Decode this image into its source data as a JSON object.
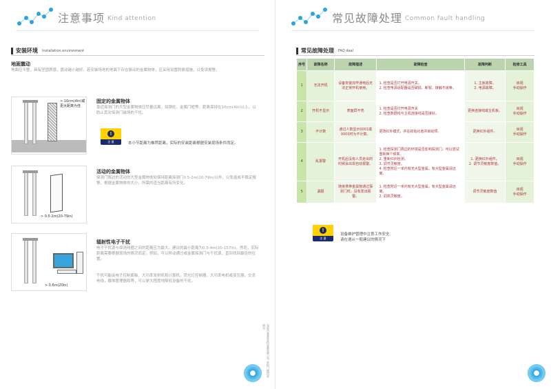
{
  "left": {
    "header": {
      "title": "注意事项",
      "title_en": "Kind attention"
    },
    "section": {
      "title": "安装环境",
      "title_en": "Installation environment"
    },
    "ground": {
      "title": "地面震动",
      "text": "地面应平整，具有坚固质感，震动越小越好。若安装场地的地面下存在振动的金属物体，应采用设置防振措施，以免误报警。"
    },
    "fig1": {
      "label": "> 10cm(4in)或更大距离为佳"
    },
    "fixed_metal": {
      "title": "固定的金属物体",
      "text": "靠近探测门的大型金属物体应尽量远离，如钢柱、金属门框等，距离保持在10cm(4in)以上，以防止其对探测门磁场的干扰。"
    },
    "note1": "本小节距离为推荐距离，实际的安装距离根据安装现场条件而定。",
    "warn_label": "注 意",
    "fig2": {
      "label": "> 0.5-2m(20-79in)"
    },
    "moving_metal": {
      "title": "活动的金属物体",
      "text": "探测门周边的活动的大型金属物体如保持距离探测门0.5-2m(20-79in)以外，以免造成不稳定报警。根据金属物体的大小，所需的适当距离有所变化。"
    },
    "fig3": {
      "label": "> 0.6m(20in)"
    },
    "radiation": {
      "title": "辐射性电子干扰",
      "text1": "电子干扰源与探测线圈之间的距离应为最大。建议的最小距离为0.5-4m(20-157in)。然而，实际距离需要根据现场的情况而定。例如，可以移动通过或金属探测门与干扰源，直到找到最佳的位置。",
      "text2": "干扰可能由电子控制面板、大功率发射机和计算机，荧光灯控制器，大功率电机或变压器，交流电线，载体管理器和等，可以更大程度地降低设备的干扰。"
    },
    "sidebar_text": "深圳市某某安检设备有限公司 安检门使用说明书"
  },
  "right": {
    "header": {
      "title": "常见故障处理",
      "title_en": "Common fault handling"
    },
    "section": {
      "title": "常见故障处理",
      "title_en": "FAQ deal"
    },
    "table": {
      "headers": [
        "序号",
        "故障名称",
        "故障描述",
        "故障检查",
        "故障判断",
        "检修工具"
      ],
      "rows": [
        {
          "num": "1",
          "name": "无法开机",
          "desc": "设备安装完毕通电后无法正常开机使用。",
          "check": "1. 检查是否打开电源开关。\n2. 检查电源适配器是否破损、断裂，接触不良等。",
          "judge": "1. 主板故障。\n2. 电源故障。",
          "tool": "目视\n手动操作"
        },
        {
          "num": "2",
          "name": "开机不显示",
          "desc": "表面屏不亮",
          "check": "1. 检查是否打开电源开关\n2. 检查数据线与主机连接线是否接好。",
          "judge": "更换连接线或主机板。",
          "tool": "目视\n手动操作"
        },
        {
          "num": "3",
          "name": "不计数",
          "desc": "通过人数显示0001或0000时为不计数。",
          "check": "更改红外模式，并在初始化者并启动项。",
          "judge": "更换红外组件。",
          "tool": "目视\n手动操作"
        },
        {
          "num": "4",
          "name": "乱报警",
          "desc": "开机后没有人员走出的时候会出现自动报警。",
          "check": "1. 检查探测门周边的环境是否影响探测门，可以尝试重新换个频率。\n2. 重新红外检测。\n3. 调节灵敏度。\n4. 检查附近一米内有无大型金属，有大型金属请远离。",
          "judge": "1. 更换红外组件。\n2. 调节灵敏度数值。",
          "tool": "目视\n手动操作"
        },
        {
          "num": "5",
          "name": "漏报",
          "desc": "随身携带金属物通过探测门时，没有发出报警。",
          "check": "1. 检查附近一米内有无大型金属，有大型金属请远离。\n2. 调高灵敏度。",
          "judge": "调节灵敏度数值",
          "tool": "目视\n手动操作"
        }
      ]
    },
    "warn_label": "注 意",
    "note": "设备维护管理中注意工作安全\n请在遵从一般建议的情况下"
  },
  "colors": {
    "accent_blue": "#2aa4e0",
    "table_header": "#bcd3b0",
    "table_green": "#c8e6a8",
    "warn_yellow": "#ffd200"
  }
}
